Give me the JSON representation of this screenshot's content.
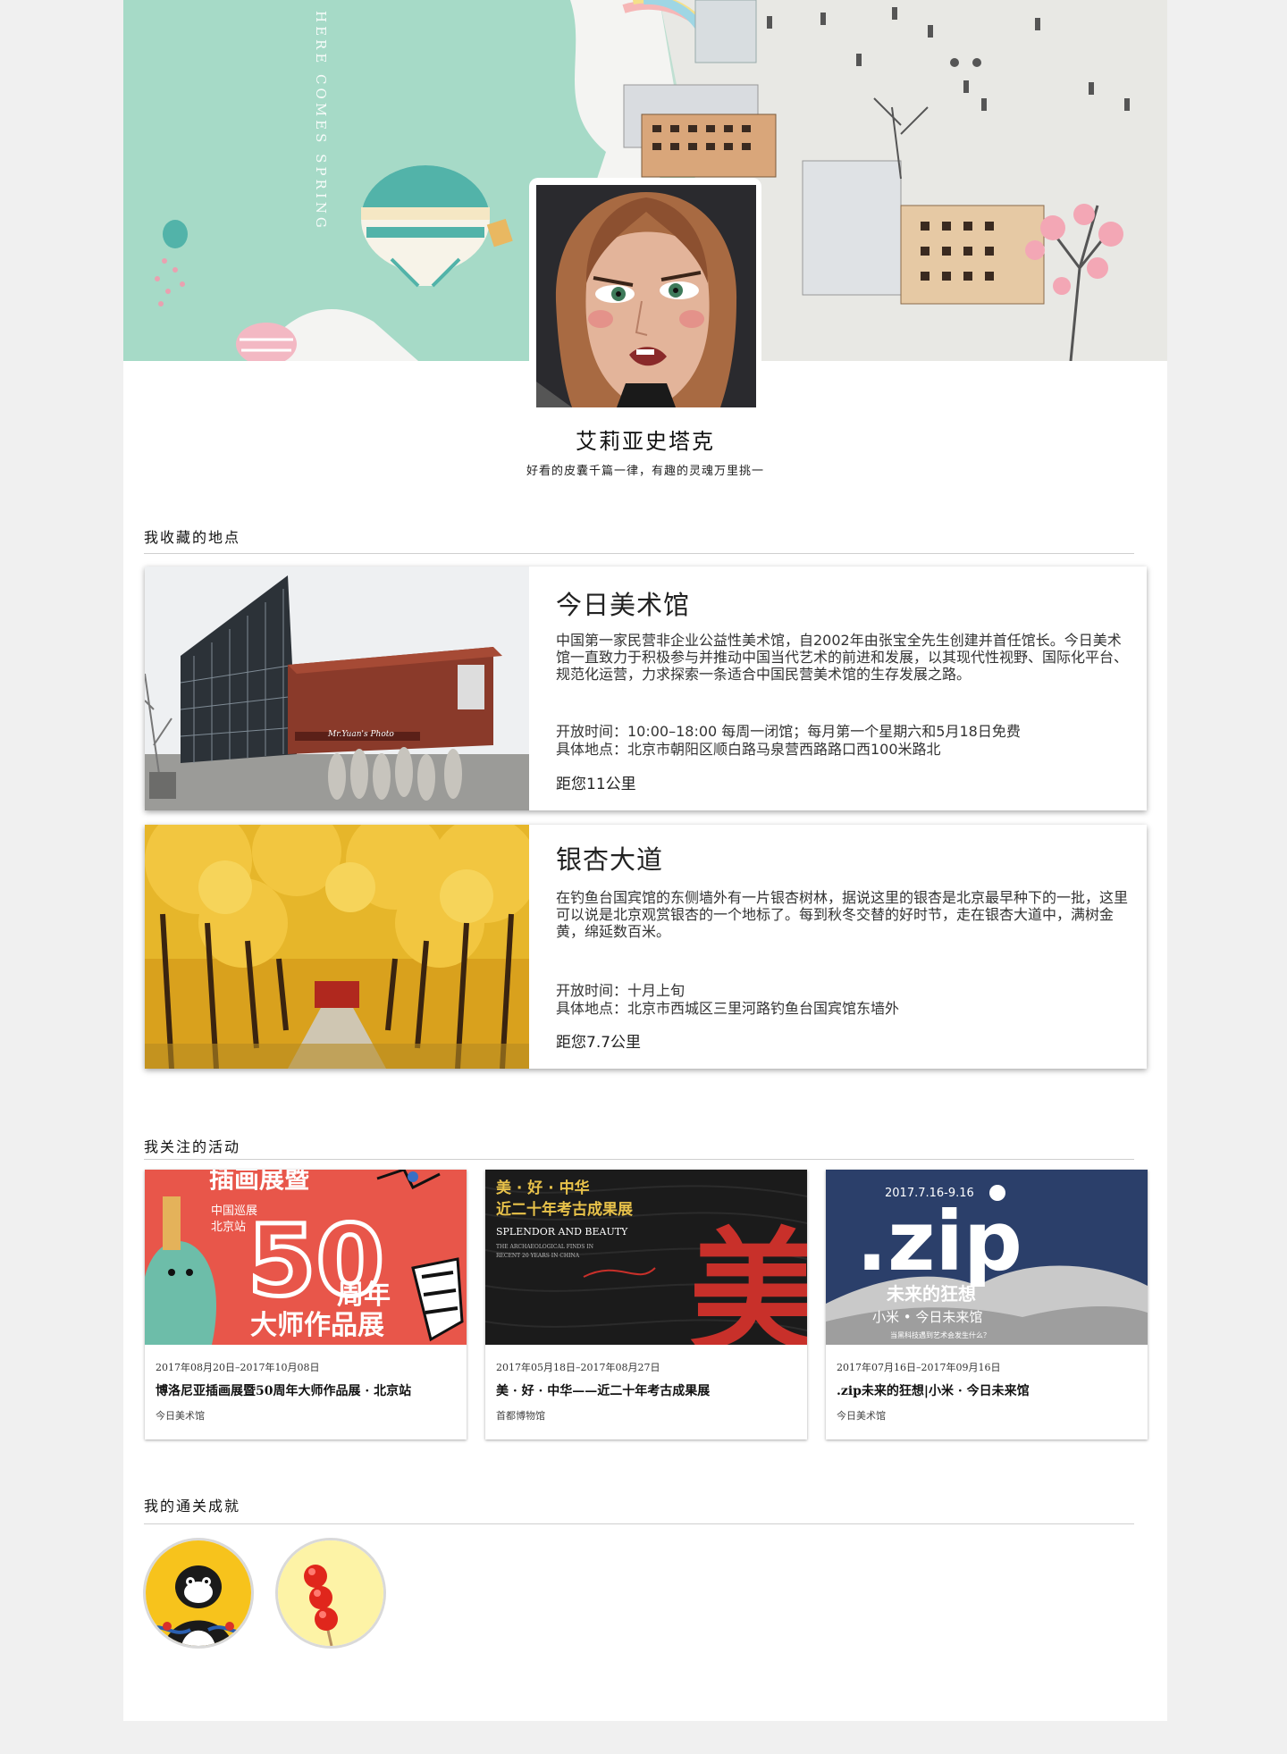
{
  "profile": {
    "banner_text": "HERE COMES SPRING",
    "name": "艾莉亚史塔克",
    "motto": "好看的皮囊千篇一律，有趣的灵魂万里挑一"
  },
  "sections": {
    "places_title": "我收藏的地点",
    "events_title": "我关注的活动",
    "achievements_title": "我的通关成就"
  },
  "places": [
    {
      "title": "今日美术馆",
      "description": "中国第一家民营非企业公益性美术馆，自2002年由张宝全先生创建并首任馆长。今日美术馆一直致力于积极参与并推动中国当代艺术的前进和发展，以其现代性视野、国际化平台、规范化运营，力求探索一条适合中国民营美术馆的生存发展之路。",
      "hours": "开放时间：10:00–18:00 每周一闭馆；每月第一个星期六和5月18日免费",
      "address": "具体地点：北京市朝阳区顺白路马泉营西路路口西100米路北",
      "distance": "距您11公里",
      "photo_sign": "Mr.Yuan's Photo"
    },
    {
      "title": "银杏大道",
      "description": "在钓鱼台国宾馆的东侧墙外有一片银杏树林，据说这里的银杏是北京最早种下的一批，这里可以说是北京观赏银杏的一个地标了。每到秋冬交替的好时节，走在银杏大道中，满树金黄，绵延数百米。",
      "hours": "开放时间：十月上旬",
      "address": "具体地点：北京市西城区三里河路钓鱼台国宾馆东墙外",
      "distance": "距您7.7公里"
    }
  ],
  "events": [
    {
      "poster": {
        "headline": "插画展暨",
        "tag_line1": "中国巡展",
        "tag_line2": "北京站",
        "big_number": "50",
        "line1": "周年",
        "line2": "大师作品展"
      },
      "date": "2017年08月20日–2017年10月08日",
      "title": "博洛尼亚插画展暨50周年大师作品展 · 北京站",
      "venue": "今日美术馆"
    },
    {
      "poster": {
        "line1": "美 · 好 · 中华",
        "line2": "近二十年考古成果展",
        "en1": "SPLENDOR AND BEAUTY",
        "en2": "THE ARCHAEOLOGICAL FINDS IN",
        "en3": "RECENT 20 YEARS IN CHINA",
        "big_char": "美"
      },
      "date": "2017年05月18日–2017年08月27日",
      "title": "美 · 好 · 中华——近二十年考古成果展",
      "venue": "首都博物馆"
    },
    {
      "poster": {
        "dates": "2017.7.16-9.16",
        "big_text": ".zip",
        "line1": "未来的狂想",
        "line2": "小米 • 今日未来馆",
        "line3": "当黑科技遇到艺术会发生什么？"
      },
      "date": "2017年07月16日–2017年09月16日",
      "title": ".zip未来的狂想|小米 · 今日未来馆",
      "venue": "今日美术馆"
    }
  ],
  "achievements": [
    {
      "icon": "opera-mask-bird-icon",
      "bg": "#f7c31c"
    },
    {
      "icon": "tanghulu-icon",
      "bg": "#fdf3a6"
    }
  ]
}
